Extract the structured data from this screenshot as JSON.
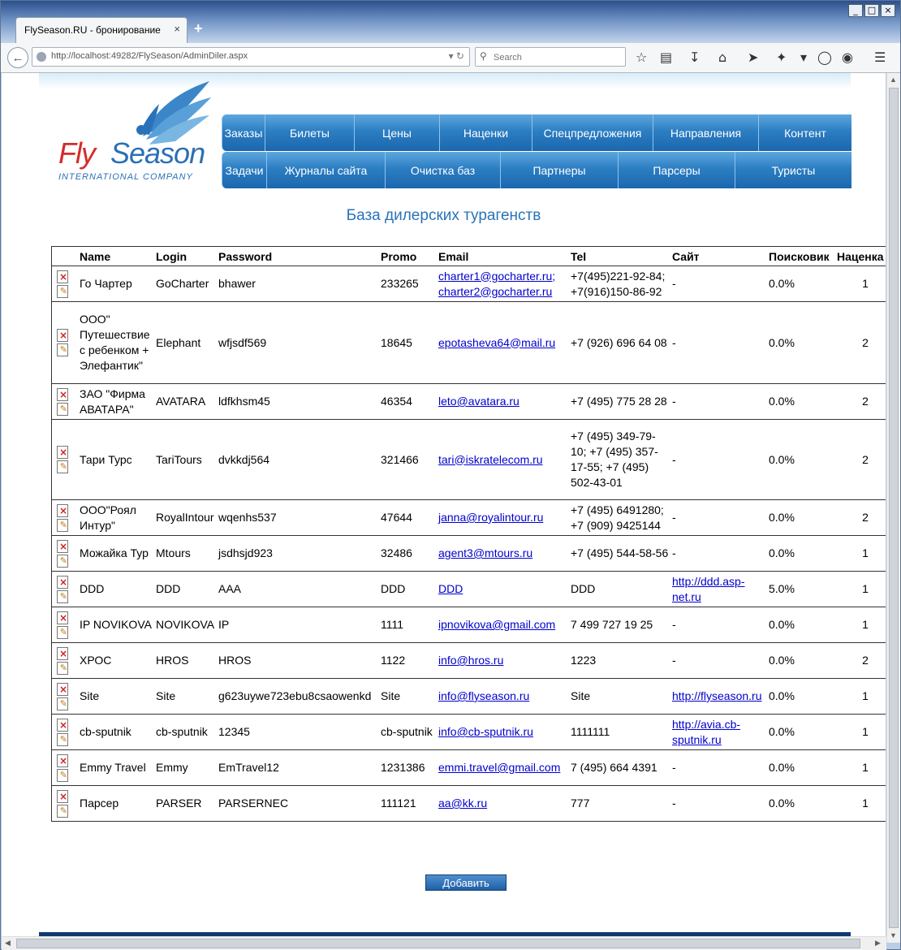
{
  "browser": {
    "tab_title": "FlySeason.RU - бронирование ча...",
    "tab_close": "×",
    "new_tab": "+",
    "url": "http://localhost:49282/FlySeason/AdminDiler.aspx",
    "search_placeholder": "Search",
    "window_min": "_",
    "window_max": "□",
    "window_close": "×"
  },
  "logo": {
    "fly": "Fly",
    "season": "Season",
    "subtitle": "INTERNATIONAL COMPANY"
  },
  "menu_row1": [
    "Заказы",
    "Билеты",
    "Цены",
    "Наценки",
    "Спецпредложения",
    "Направления",
    "Контент"
  ],
  "menu_row2": [
    "Задачи",
    "Журналы сайта",
    "Очистка баз",
    "Партнеры",
    "Парсеры",
    "Туристы"
  ],
  "page_title": "База дилерских турагенств",
  "table": {
    "columns": [
      "Name",
      "Login",
      "Password",
      "Promo",
      "Email",
      "Tel",
      "Сайт",
      "Поисковик",
      "Наценка"
    ],
    "rows": [
      {
        "name": "Го Чартер",
        "login": "GoCharter",
        "password": "bhawer",
        "promo": "233265",
        "email": "charter1@gocharter.ru; charter2@gocharter.ru",
        "tel": "+7(495)221-92-84; +7(916)150-86-92",
        "site": "-",
        "search": "0.0%",
        "markup": "1"
      },
      {
        "name": "ООО\" Путешествие с ребенком + Элефантик\"",
        "login": "Elephant",
        "password": "wfjsdf569",
        "promo": "18645",
        "email": "epotasheva64@mail.ru",
        "tel": "+7 (926) 696 64 08",
        "site": "-",
        "search": "0.0%",
        "markup": "2"
      },
      {
        "name": "ЗАО \"Фирма АВАТАРА\"",
        "login": "AVATARA",
        "password": "ldfkhsm45",
        "promo": "46354",
        "email": "leto@avatara.ru",
        "tel": "+7 (495) 775 28 28",
        "site": "-",
        "search": "0.0%",
        "markup": "2"
      },
      {
        "name": "Тари Турс",
        "login": "TariTours",
        "password": "dvkkdj564",
        "promo": "321466",
        "email": "tari@iskratelecom.ru",
        "tel": "+7 (495) 349-79-10; +7 (495) 357-17-55; +7 (495) 502-43-01",
        "site": "-",
        "search": "0.0%",
        "markup": "2"
      },
      {
        "name": "ООО\"Роял Интур\"",
        "login": "RoyalIntour",
        "password": "wqenhs537",
        "promo": "47644",
        "email": "janna@royalintour.ru",
        "tel": "+7 (495) 6491280; +7 (909) 9425144",
        "site": "-",
        "search": "0.0%",
        "markup": "2"
      },
      {
        "name": "Можайка Тур",
        "login": "Mtours",
        "password": "jsdhsjd923",
        "promo": "32486",
        "email": "agent3@mtours.ru",
        "tel": "+7 (495) 544-58-56",
        "site": "-",
        "search": "0.0%",
        "markup": "1"
      },
      {
        "name": "DDD",
        "login": "DDD",
        "password": "AAA",
        "promo": "DDD",
        "email": "DDD",
        "tel": "DDD",
        "site": "http://ddd.asp-net.ru",
        "search": "5.0%",
        "markup": "1"
      },
      {
        "name": "IP NOVIKOVA",
        "login": "NOVIKOVA",
        "password": "IP",
        "promo": "1111",
        "email": "ipnovikova@gmail.com",
        "tel": "7 499 727 19 25",
        "site": "-",
        "search": "0.0%",
        "markup": "1"
      },
      {
        "name": "ХРОС",
        "login": "HROS",
        "password": "HROS",
        "promo": "1122",
        "email": "info@hros.ru",
        "tel": "1223",
        "site": "-",
        "search": "0.0%",
        "markup": "2"
      },
      {
        "name": "Site",
        "login": "Site",
        "password": "g623uywe723ebu8csaowenkd",
        "promo": "Site",
        "email": "info@flyseason.ru",
        "tel": "Site",
        "site": "http://flyseason.ru",
        "search": "0.0%",
        "markup": "1"
      },
      {
        "name": "cb-sputnik",
        "login": "cb-sputnik",
        "password": "12345",
        "promo": "cb-sputnik",
        "email": "info@cb-sputnik.ru",
        "tel": "1111111",
        "site": "http://avia.cb-sputnik.ru",
        "search": "0.0%",
        "markup": "1"
      },
      {
        "name": "Emmy Travel",
        "login": "Emmy",
        "password": "EmTravel12",
        "promo": "1231386",
        "email": "emmi.travel@gmail.com",
        "tel": "7 (495) 664 4391",
        "site": "-",
        "search": "0.0%",
        "markup": "1"
      },
      {
        "name": "Парсер",
        "login": "PARSER",
        "password": "PARSERNEC",
        "promo": "111121",
        "email": "aa@kk.ru",
        "tel": "777",
        "site": "-",
        "search": "0.0%",
        "markup": "1"
      }
    ]
  },
  "add_button": "Добавить",
  "icons": {
    "delete": "delete-icon",
    "edit": "edit-icon"
  },
  "colors": {
    "menu_blue": "#2c7ec3",
    "heading_blue": "#2a73b8",
    "logo_red": "#d62a2a",
    "logo_blue": "#2b6fb6",
    "link": "#0000cc"
  }
}
